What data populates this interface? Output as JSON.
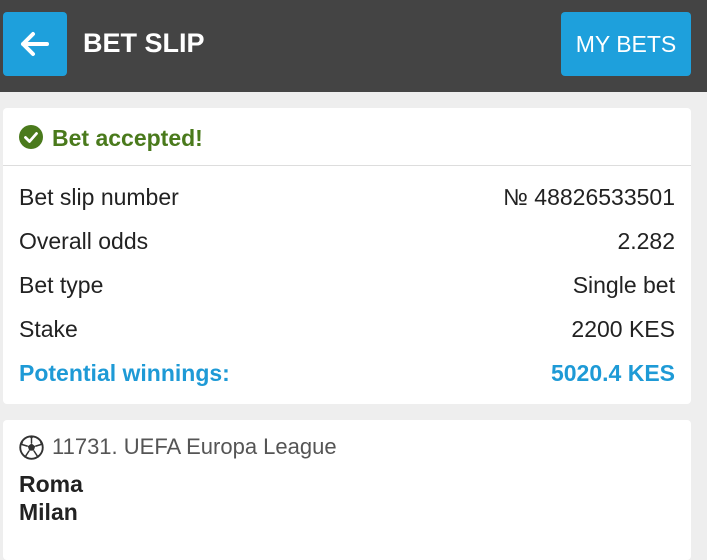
{
  "header": {
    "back_icon": "arrow-left-icon",
    "title": "BET SLIP",
    "my_bets_label": "MY BETS"
  },
  "summary": {
    "status_icon": "check-circle-icon",
    "status_text": "Bet accepted!",
    "rows": [
      {
        "label": "Bet slip number",
        "value": "№ 48826533501"
      },
      {
        "label": "Overall odds",
        "value": "2.282"
      },
      {
        "label": "Bet type",
        "value": "Single bet"
      },
      {
        "label": "Stake",
        "value": "2200 KES"
      },
      {
        "label": "Potential winnings:",
        "value": "5020.4 KES"
      }
    ]
  },
  "event": {
    "sport_icon": "soccer-ball-icon",
    "league": "11731. UEFA Europa League",
    "team1": "Roma",
    "team2": "Milan"
  },
  "colors": {
    "header_bg": "#444444",
    "accent": "#1ea0dc",
    "success": "#4a7a1c"
  }
}
